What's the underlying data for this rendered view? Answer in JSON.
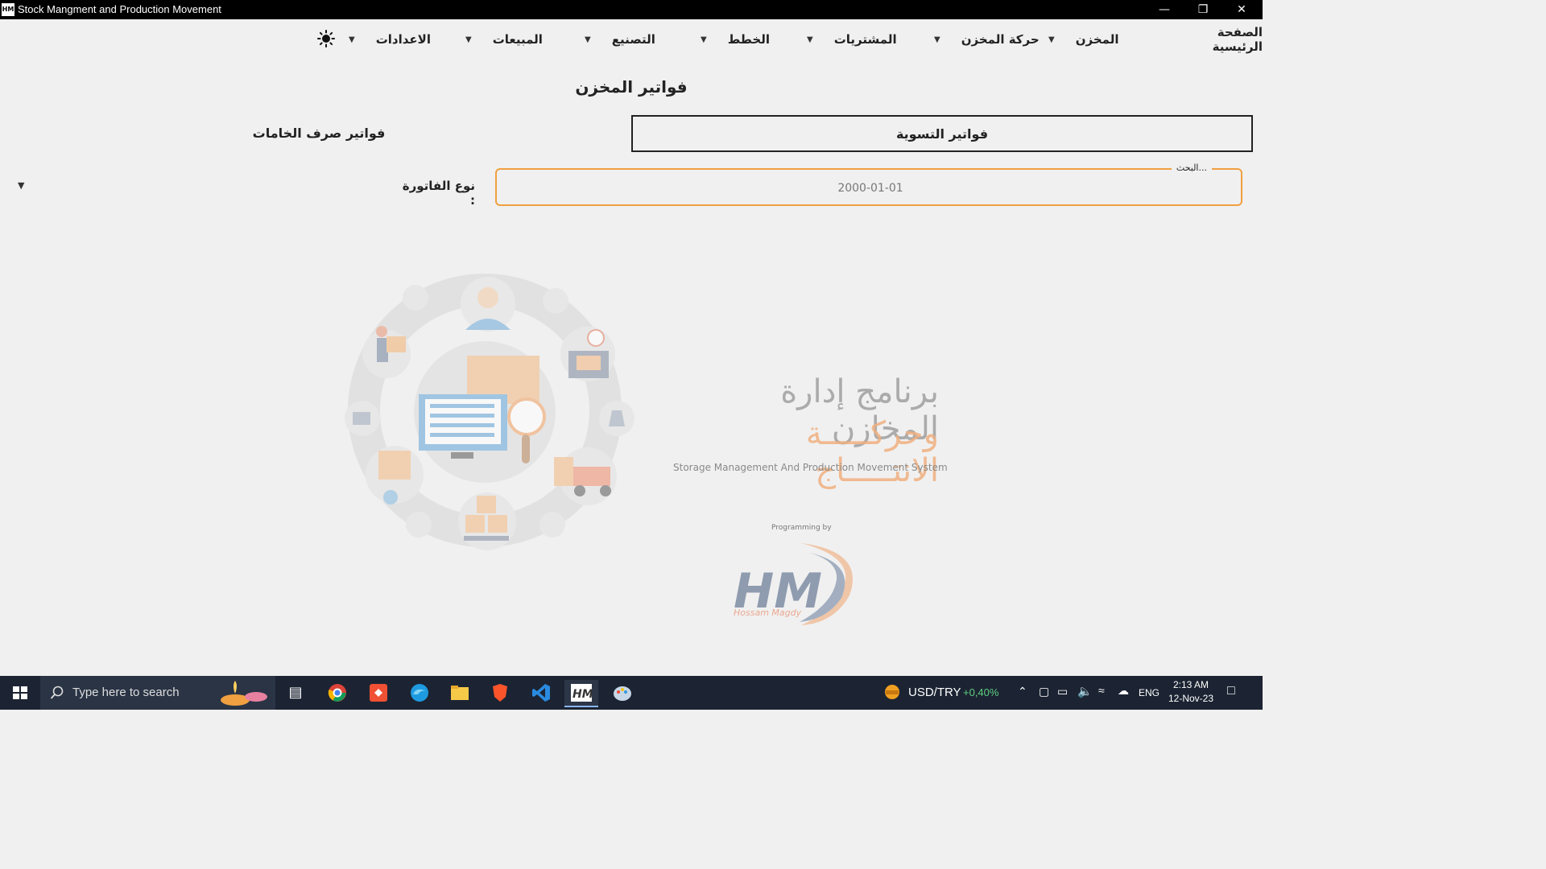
{
  "window": {
    "title": "Stock Mangment and Production Movement",
    "app_icon_text": "HM"
  },
  "menu": {
    "items": [
      {
        "label": "الصفحة الرئيسية"
      },
      {
        "label": "المخزن"
      },
      {
        "label": "حركة المخزن"
      },
      {
        "label": "المشتريات"
      },
      {
        "label": "الخطط"
      },
      {
        "label": "التصنيع"
      },
      {
        "label": "المبيعات"
      },
      {
        "label": "الاعدادات"
      }
    ],
    "theme_icon": "sun-icon"
  },
  "page": {
    "title": "فواتير المخزن",
    "tabs": [
      {
        "label": "فواتير التسوية",
        "active": true
      },
      {
        "label": "فواتير صرف الخامات",
        "active": false
      }
    ],
    "search": {
      "legend": "البحث...",
      "value": "2000-01-01"
    },
    "invoice_type_label": "نوع الفاتورة :"
  },
  "branding": {
    "title_line1": "برنامج إدارة المخازن",
    "title_line2": "وحركـــــة الانتـــــاج",
    "subtitle": "Storage Management And Production Movement System",
    "programmed_by": "Programming by",
    "logo_text": "HM",
    "logo_name": "Hossam Magdy",
    "accent_color": "#f0a040"
  },
  "taskbar": {
    "search_placeholder": "Type here to search",
    "ticker": "USD/TRY",
    "ticker_change": "+0,40%",
    "language": "ENG",
    "time": "2:13 AM",
    "date": "12-Nov-23"
  }
}
